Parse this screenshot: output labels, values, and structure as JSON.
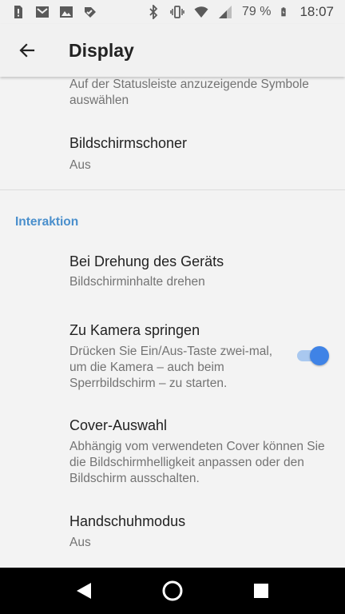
{
  "status_bar": {
    "left_icons": [
      "alert-icon",
      "mail-icon",
      "image-icon",
      "check-app-icon"
    ],
    "right_icons": [
      "bluetooth-icon",
      "vibrate-icon",
      "wifi-icon",
      "signal-icon",
      "battery-icon"
    ],
    "battery_percent": "79 %",
    "time": "18:07"
  },
  "app_bar": {
    "title": "Display"
  },
  "items": {
    "status_icons": {
      "subtitle": "Auf der Statusleiste anzuzeigende Symbole auswählen"
    },
    "screensaver": {
      "title": "Bildschirmschoner",
      "subtitle": "Aus"
    },
    "section_interaction": "Interaktion",
    "rotation": {
      "title": "Bei Drehung des Geräts",
      "subtitle": "Bildschirminhalte drehen"
    },
    "camera_jump": {
      "title": "Zu Kamera springen",
      "subtitle": "Drücken Sie Ein/Aus-Taste zwei-mal, um die Kamera – auch beim Sperrbildschirm – zu starten.",
      "enabled": true
    },
    "cover": {
      "title": "Cover-Auswahl",
      "subtitle": "Abhängig vom verwendeten Cover können Sie die Bildschirmhelligkeit anpassen oder den Bildschirm ausschalten."
    },
    "glove_mode": {
      "title": "Handschuhmodus",
      "subtitle": "Aus"
    }
  },
  "colors": {
    "accent": "#4a8fcc",
    "toggle_on": "#3f83e6"
  },
  "nav_bar": {
    "buttons": [
      "back-triangle-icon",
      "home-circle-icon",
      "recents-square-icon"
    ]
  }
}
